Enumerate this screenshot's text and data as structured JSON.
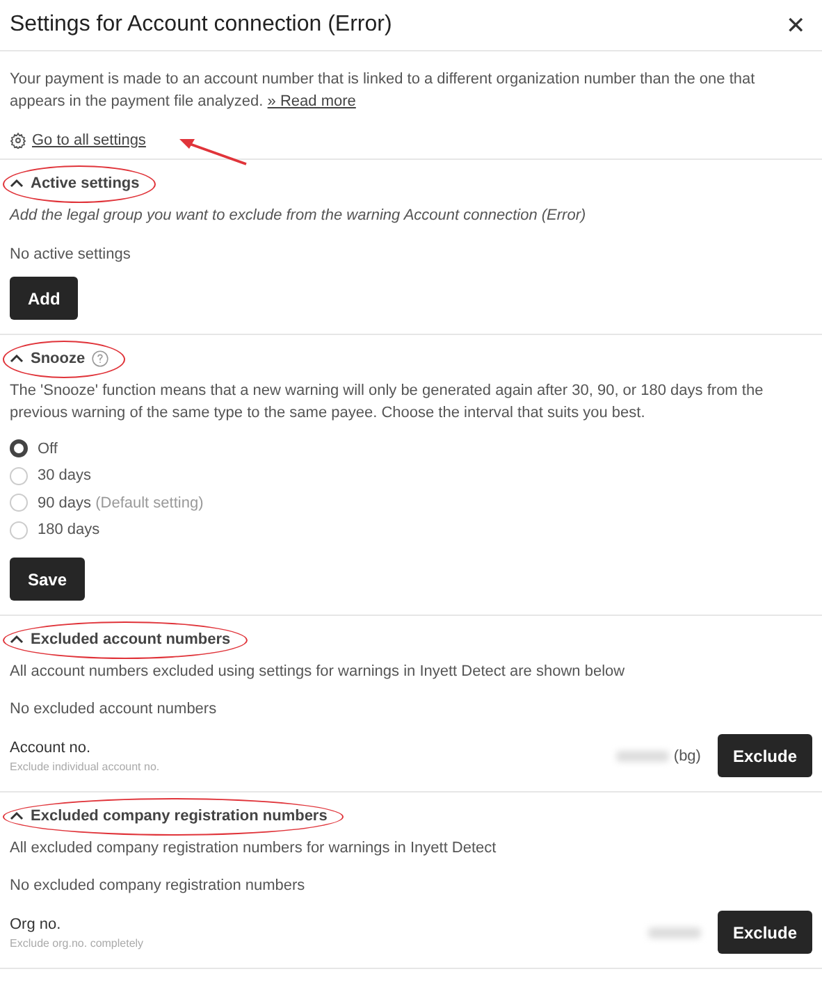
{
  "dialog": {
    "title": "Settings for Account connection (Error)",
    "close_label": "✕"
  },
  "intro": {
    "text": "Your payment is made to an account number that is linked to a different organization number than the one that appears in the payment file analyzed.",
    "read_more": "» Read more",
    "settings_link": "Go to all settings",
    "arrow_annotation": true
  },
  "sections": [
    {
      "kind": "list",
      "title": "Active settings",
      "expanded": true,
      "circled": true,
      "description": "Add the legal group you want to exclude from the warning Account connection (Error)",
      "description_italic": true,
      "empty_text": "No active settings",
      "button": "Add"
    },
    {
      "kind": "radio",
      "title": "Snooze",
      "expanded": true,
      "circled": true,
      "help_icon": true,
      "description": "The 'Snooze' function means that a new warning will only be generated again after 30, 90, or 180 days from the previous warning of the same type to the same payee. Choose the interval that suits you best.",
      "options": [
        {
          "label": "Off",
          "selected": true
        },
        {
          "label": "30 days",
          "selected": false
        },
        {
          "label": "90 days",
          "note": "(Default setting)",
          "selected": false
        },
        {
          "label": "180 days",
          "selected": false
        }
      ],
      "button": "Save"
    },
    {
      "kind": "exclude",
      "title": "Excluded account numbers",
      "expanded": true,
      "circled": true,
      "description": "All account numbers excluded using settings for warnings in Inyett Detect are shown below",
      "empty_text": "No excluded account numbers",
      "field_label": "Account no.",
      "field_hint": "Exclude individual account no.",
      "value_suffix": "(bg)",
      "button": "Exclude"
    },
    {
      "kind": "exclude",
      "title": "Excluded company registration numbers",
      "expanded": true,
      "circled": true,
      "description": "All excluded company registration numbers for warnings in Inyett Detect",
      "empty_text": "No excluded company registration numbers",
      "field_label": "Org no.",
      "field_hint": "Exclude org.no. completely",
      "button": "Exclude"
    }
  ]
}
